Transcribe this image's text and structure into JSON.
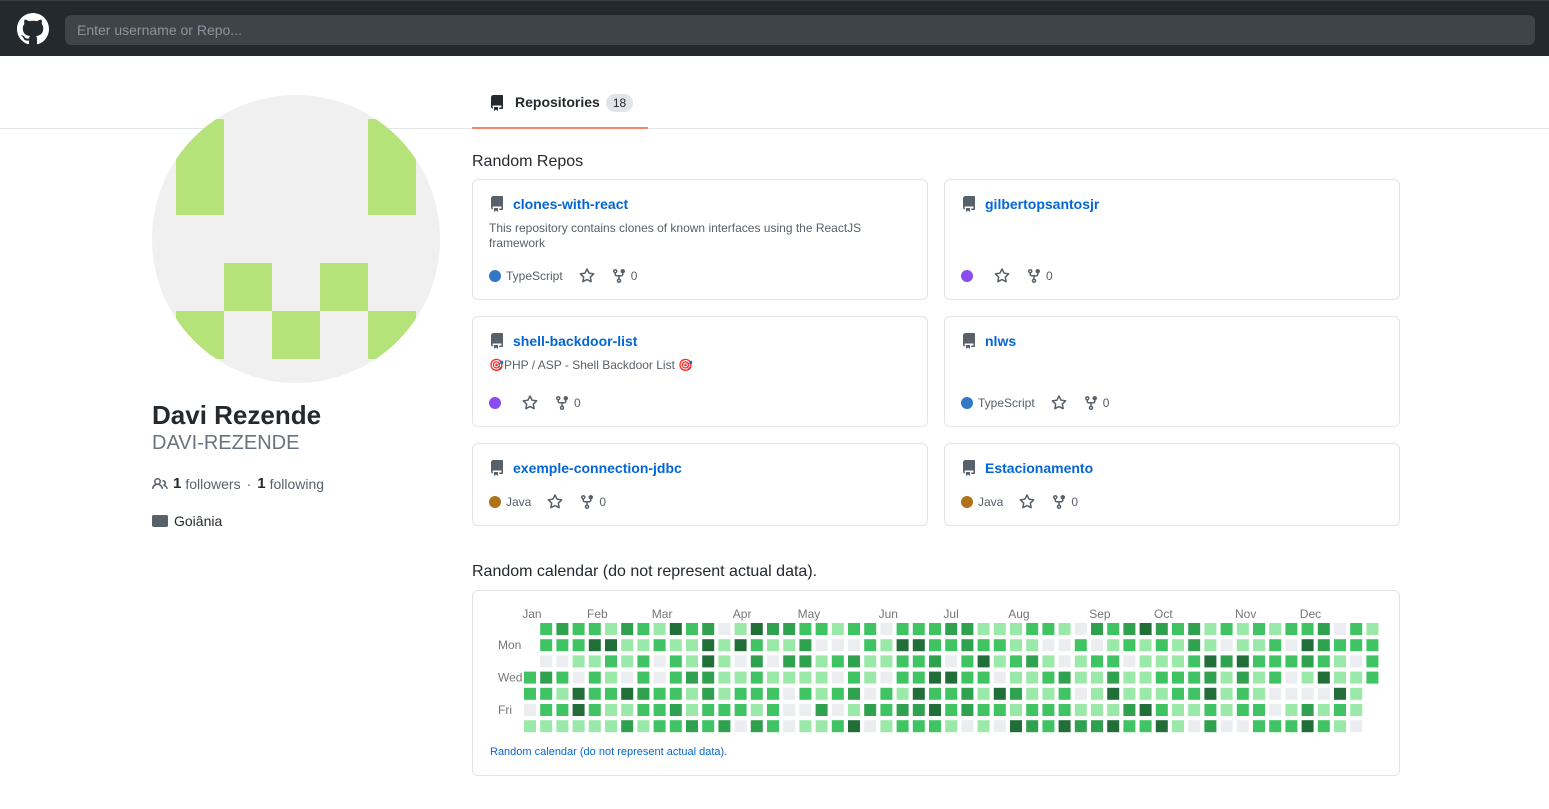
{
  "search": {
    "placeholder": "Enter username or Repo..."
  },
  "tabs": {
    "repositories_label": "Repositories",
    "repositories_count": "18"
  },
  "profile": {
    "name": "Davi Rezende",
    "login": "DAVI-REZENDE",
    "followers": "1",
    "followers_label": "followers",
    "separator": "·",
    "following": "1",
    "following_label": "following",
    "location": "Goiânia"
  },
  "repos_section": {
    "title": "Random Repos"
  },
  "repos": [
    {
      "name": "clones-with-react",
      "description": "This repository contains clones of known interfaces using the ReactJS framework",
      "language": "TypeScript",
      "language_color": "#3178c6",
      "forks": "0"
    },
    {
      "name": "gilbertopsantosjr",
      "description": "",
      "language": "",
      "language_color": "#8a4bf0",
      "forks": "0"
    },
    {
      "name": "shell-backdoor-list",
      "description": "🎯PHP / ASP - Shell Backdoor List 🎯",
      "language": "",
      "language_color": "#8a4bf0",
      "forks": "0"
    },
    {
      "name": "nlws",
      "description": "",
      "language": "TypeScript",
      "language_color": "#3178c6",
      "forks": "0"
    },
    {
      "name": "exemple-connection-jdbc",
      "description": "",
      "language": "Java",
      "language_color": "#b07219",
      "forks": "0"
    },
    {
      "name": "Estacionamento",
      "description": "",
      "language": "Java",
      "language_color": "#b07219",
      "forks": "0"
    }
  ],
  "calendar": {
    "title": "Random calendar (do not represent actual data).",
    "note": "Random calendar (do not represent actual data).",
    "months": [
      "Jan",
      "Feb",
      "Mar",
      "Apr",
      "May",
      "Jun",
      "Jul",
      "Aug",
      "Sep",
      "Oct",
      "Nov",
      "Dec"
    ],
    "weekdays": [
      "Mon",
      "Wed",
      "Fri"
    ],
    "colors": [
      "#ebedf0",
      "#9be9a8",
      "#40c463",
      "#30a14e",
      "#216e39"
    ]
  },
  "colors": {
    "link": "#0366d6",
    "tab_accent": "#f9826c",
    "avatar_green": "#b6e27a"
  }
}
